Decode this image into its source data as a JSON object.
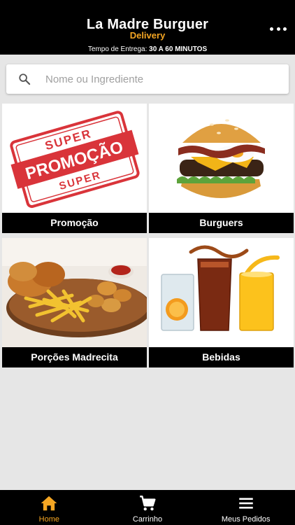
{
  "header": {
    "title": "La Madre Burguer",
    "subtitle": "Delivery",
    "delivery_label": "Tempo de Entrega:",
    "delivery_value": "30 A 60 MINUTOS"
  },
  "search": {
    "placeholder": "Nome ou Ingrediente",
    "value": ""
  },
  "categories": [
    {
      "label": "Promoção",
      "stamp_top": "SUPER",
      "stamp_main": "PROMOÇÃO",
      "stamp_bottom": "SUPER"
    },
    {
      "label": "Burguers"
    },
    {
      "label": "Porções Madrecita"
    },
    {
      "label": "Bebidas"
    }
  ],
  "bottom_nav": [
    {
      "label": "Home",
      "icon": "home-icon",
      "active": true
    },
    {
      "label": "Carrinho",
      "icon": "cart-icon",
      "active": false
    },
    {
      "label": "Meus Pedidos",
      "icon": "list-icon",
      "active": false
    }
  ],
  "colors": {
    "accent": "#f5a623",
    "header_bg": "#000000",
    "stamp_red": "#d9343a"
  }
}
